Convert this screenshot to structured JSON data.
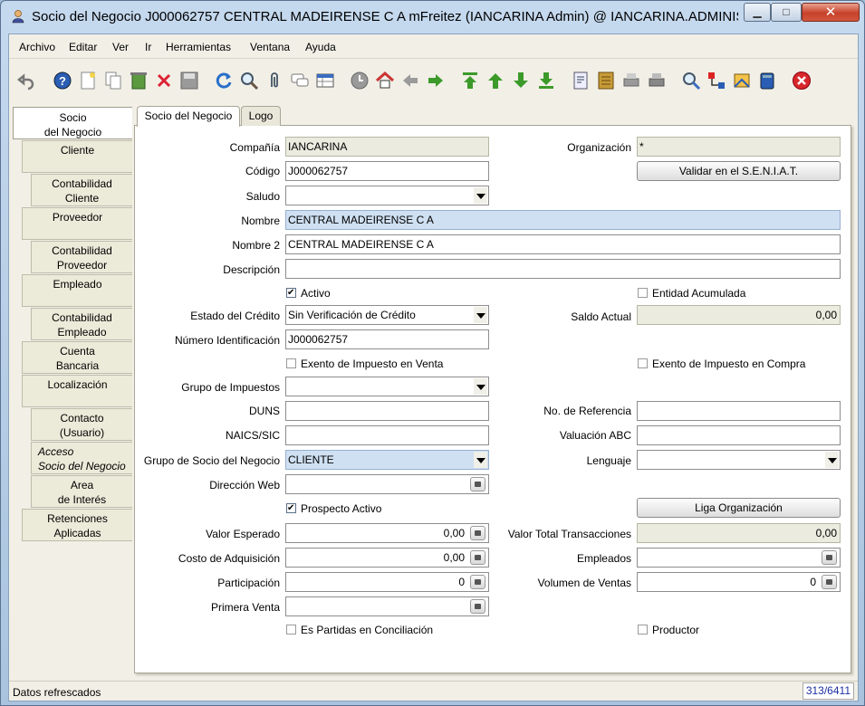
{
  "window": {
    "title": "Socio del Negocio  J000062757  CENTRAL MADEIRENSE  C A  mFreitez (IANCARINA Admin) @ IANCARINA.ADMINIST...",
    "minimize": "▁",
    "maximize": "□",
    "close": "✕"
  },
  "menu": [
    "Archivo",
    "Editar",
    "Ver",
    "Ir",
    "Herramientas",
    "Ventana",
    "Ayuda"
  ],
  "side_tabs": [
    {
      "label": "Socio\ndel Negocio"
    },
    {
      "label": "Cliente"
    },
    {
      "label": "Contabilidad\nCliente"
    },
    {
      "label": "Proveedor"
    },
    {
      "label": "Contabilidad\nProveedor"
    },
    {
      "label": "Empleado"
    },
    {
      "label": "Contabilidad\nEmpleado"
    },
    {
      "label": "Cuenta\nBancaria"
    },
    {
      "label": "Localización"
    },
    {
      "label": "Contacto\n(Usuario)"
    },
    {
      "label": "Acceso\nSocio del Negocio"
    },
    {
      "label": "Area\nde Interés"
    },
    {
      "label": "Retenciones\nAplicadas"
    }
  ],
  "panel_tabs": [
    "Socio del Negocio",
    "Logo"
  ],
  "form": {
    "compania": {
      "label": "Compañía",
      "value": "IANCARINA"
    },
    "organizacion": {
      "label": "Organización",
      "value": "*"
    },
    "codigo": {
      "label": "Código",
      "value": "J000062757"
    },
    "validar_button": "Validar en el S.E.N.I.A.T.",
    "saludo": {
      "label": "Saludo",
      "value": ""
    },
    "nombre": {
      "label": "Nombre",
      "value": "CENTRAL MADEIRENSE  C A"
    },
    "nombre2": {
      "label": "Nombre 2",
      "value": "CENTRAL MADEIRENSE  C A"
    },
    "descripcion": {
      "label": "Descripción",
      "value": ""
    },
    "activo": {
      "label": "Activo",
      "checked": true
    },
    "entidad_acumulada": {
      "label": "Entidad Acumulada",
      "checked": false
    },
    "estado_credito": {
      "label": "Estado del Crédito",
      "value": "Sin Verificación de Crédito"
    },
    "saldo_actual": {
      "label": "Saldo Actual",
      "value": "0,00"
    },
    "numero_identificacion": {
      "label": "Número Identificación",
      "value": "J000062757"
    },
    "exento_venta": {
      "label": "Exento de Impuesto en Venta",
      "checked": false
    },
    "exento_compra": {
      "label": "Exento de Impuesto en Compra",
      "checked": false
    },
    "grupo_impuestos": {
      "label": "Grupo de Impuestos",
      "value": ""
    },
    "duns": {
      "label": "DUNS",
      "value": ""
    },
    "no_referencia": {
      "label": "No. de Referencia",
      "value": ""
    },
    "naics": {
      "label": "NAICS/SIC",
      "value": ""
    },
    "valuacion_abc": {
      "label": "Valuación ABC",
      "value": ""
    },
    "grupo_socio": {
      "label": "Grupo de Socio del Negocio",
      "value": "CLIENTE"
    },
    "lenguaje": {
      "label": "Lenguaje",
      "value": ""
    },
    "direccion_web": {
      "label": "Dirección Web",
      "value": ""
    },
    "prospecto_activo": {
      "label": "Prospecto Activo",
      "checked": true
    },
    "liga_button": "Liga Organización",
    "valor_esperado": {
      "label": "Valor Esperado",
      "value": "0,00"
    },
    "valor_total": {
      "label": "Valor Total Transacciones",
      "value": "0,00"
    },
    "costo_adquisicion": {
      "label": "Costo de Adquisición",
      "value": "0,00"
    },
    "empleados": {
      "label": "Empleados",
      "value": ""
    },
    "participacion": {
      "label": "Participación",
      "value": "0"
    },
    "volumen_ventas": {
      "label": "Volumen de Ventas",
      "value": "0"
    },
    "primera_venta": {
      "label": "Primera Venta",
      "value": ""
    },
    "es_partidas": {
      "label": "Es Partidas en Conciliación",
      "checked": false
    },
    "productor": {
      "label": "Productor",
      "checked": false
    }
  },
  "status": {
    "message": "Datos refrescados",
    "record": "313/6411"
  },
  "toolbar_icons": [
    "undo-icon",
    "help-icon",
    "new-icon",
    "copy-icon",
    "recycle-icon",
    "delete-icon",
    "save-icon",
    "refresh-icon",
    "find-icon",
    "attachment-icon",
    "chat-icon",
    "grid-toggle-icon",
    "history-icon",
    "home-icon",
    "back-icon",
    "forward-icon",
    "first-icon",
    "previous-icon",
    "next-icon",
    "last-icon",
    "report-icon",
    "archive-icon",
    "print-preview-icon",
    "print-icon",
    "zoom-across-icon",
    "workflow-icon",
    "request-icon",
    "product-info-icon",
    "exit-icon"
  ],
  "colors": {
    "accent": "#c5d9ee",
    "highlight": "#cfe0f2",
    "readonly": "#ebebdf",
    "close": "#d2573e"
  }
}
